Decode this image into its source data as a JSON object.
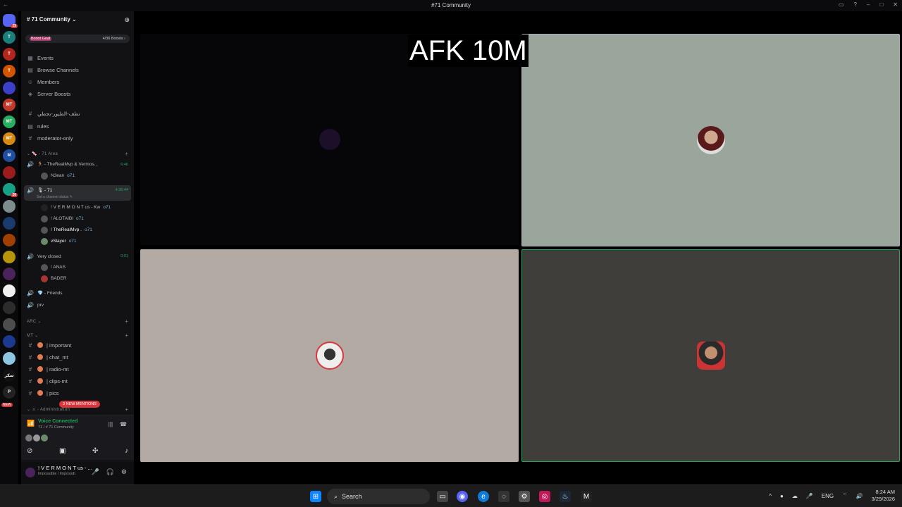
{
  "window": {
    "title": "#71 Community"
  },
  "rail": {
    "servers": [
      {
        "icon": "discord-home-icon",
        "color": "#5865f2",
        "badge": "29"
      },
      {
        "icon": "server-icon",
        "color": "#1a7f7a",
        "label": "T"
      },
      {
        "icon": "server-icon",
        "color": "#b3261e",
        "label": "T"
      },
      {
        "icon": "server-icon",
        "color": "#d35400",
        "label": "T"
      },
      {
        "icon": "folder-icon",
        "color": "#3c3fc8",
        "label": ""
      },
      {
        "icon": "server-icon",
        "color": "#c0392b",
        "label": "MT"
      },
      {
        "icon": "server-icon",
        "color": "#27ae60",
        "label": "MT"
      },
      {
        "icon": "server-icon",
        "color": "#d68910",
        "label": "MT"
      },
      {
        "icon": "server-icon",
        "color": "#1f4fa0",
        "label": "M"
      },
      {
        "icon": "server-icon",
        "color": "#9b1c1c",
        "label": ""
      },
      {
        "icon": "server-icon",
        "color": "#16a085",
        "label": "",
        "badge": "26"
      },
      {
        "icon": "server-icon",
        "color": "#7f8c8d",
        "label": ""
      },
      {
        "icon": "server-icon",
        "color": "#1a3b6b",
        "label": ""
      },
      {
        "icon": "server-icon",
        "color": "#a04000",
        "label": ""
      },
      {
        "icon": "server-icon",
        "color": "#b7950b",
        "label": ""
      },
      {
        "icon": "server-icon",
        "color": "#4a235a",
        "label": ""
      },
      {
        "icon": "server-icon",
        "color": "#f0f0f0",
        "label": ""
      },
      {
        "icon": "server-icon",
        "color": "#2c2c2c",
        "label": ""
      },
      {
        "icon": "server-icon",
        "color": "#4d4d4d",
        "label": ""
      },
      {
        "icon": "server-icon",
        "color": "#1b3a8f",
        "label": ""
      },
      {
        "icon": "server-icon",
        "color": "#8ec5e0",
        "label": ""
      },
      {
        "icon": "server-icon",
        "color": "#111",
        "label": "ﺳﻜﺮ"
      },
      {
        "icon": "server-icon",
        "color": "#222",
        "label": "P"
      }
    ],
    "new_label": "NEW"
  },
  "sidebar": {
    "server_name": "# 71 Community",
    "boost_goal": "Boost Goal",
    "boost_count": "4/36 Boosts",
    "menu": [
      {
        "icon": "calendar-icon",
        "label": "Events"
      },
      {
        "icon": "browse-icon",
        "label": "Browse Channels"
      },
      {
        "icon": "members-icon",
        "label": "Members"
      },
      {
        "icon": "boost-icon",
        "label": "Server Boosts"
      }
    ],
    "channels_top": [
      "ﻧﻄﻒ-اﻟﻄﻴﻮر-ﺑﺠﻄﻲ",
      "rules",
      "moderator-only"
    ],
    "cat_71area": "71 Area",
    "vc1": {
      "name": "TheRealMvp & Vermos...",
      "time": "6:46",
      "users": [
        "N3ean"
      ]
    },
    "vc2": {
      "name": "71",
      "time": "4:36:44",
      "status": "Set a channel status",
      "users": [
        "! V E R M O N T us - Kw",
        "! ALOTAIBI",
        "! TheRealMvp .",
        "vSlayer"
      ]
    },
    "vc3": {
      "name": "Very closed",
      "time": "0:01",
      "users": [
        "! ANAS",
        "BADER"
      ]
    },
    "vc4": {
      "name": "Friends"
    },
    "vc5": {
      "name": "prv"
    },
    "cat_arc": "ARC",
    "cat_mt": "MT",
    "mt_channels": [
      "| important",
      "| chat_mt",
      "| radio-mt",
      "| clips-mt",
      "| pics"
    ],
    "cat_admin": "Administration",
    "user_tag": "o71",
    "mention_label": "3 NEW MENTIONS"
  },
  "voice": {
    "status": "Voice Connected",
    "channel": "71 / # 71 Community"
  },
  "user": {
    "name": "! V E R M O N T us - ...",
    "status": "Impossible / Impossib"
  },
  "stage": {
    "overlay": "AFK 10M"
  },
  "taskbar": {
    "search": "Search",
    "lang": "ENG",
    "time": "8:24 AM",
    "date": "3/29/2026"
  }
}
